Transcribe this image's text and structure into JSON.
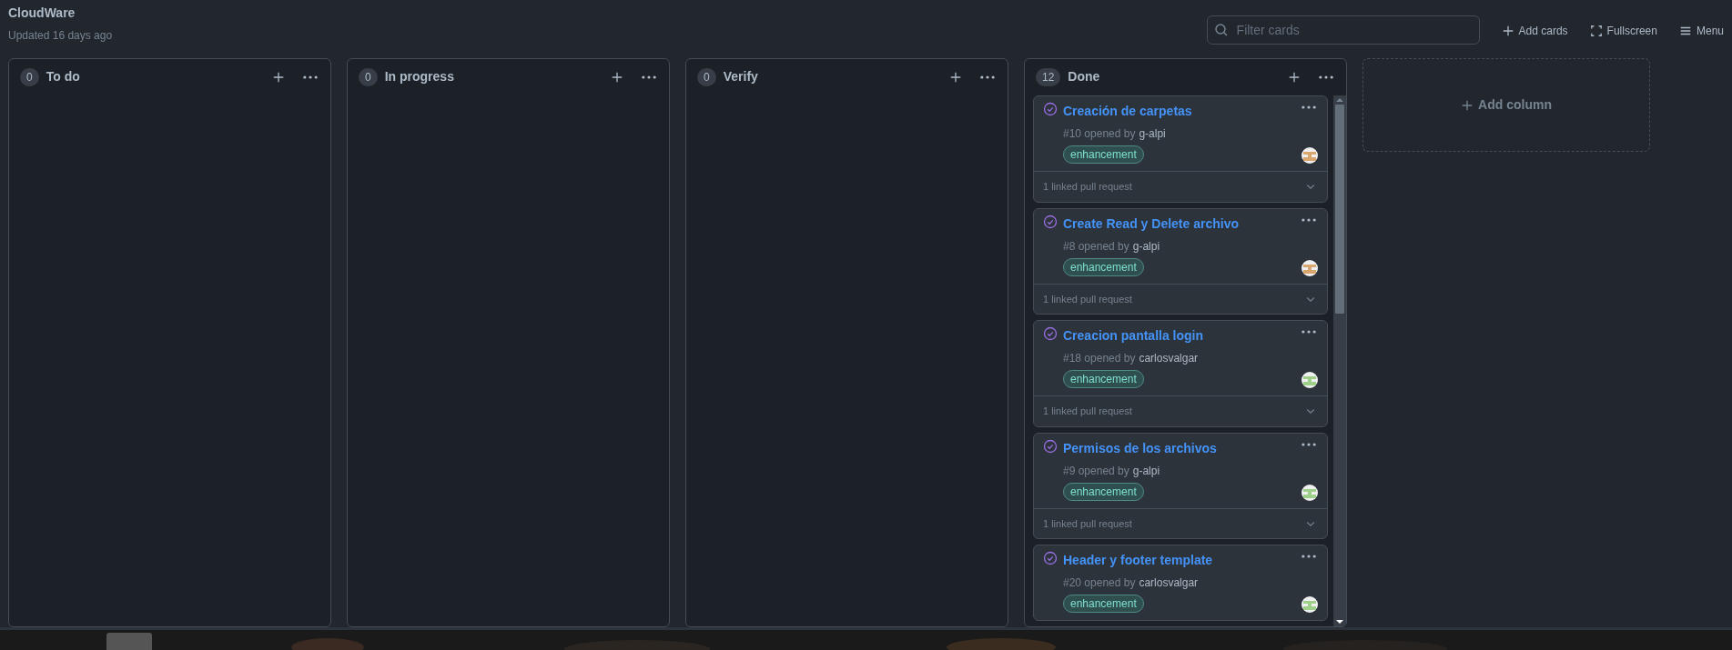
{
  "board": {
    "title": "CloudWare",
    "updated": "Updated 16 days ago"
  },
  "toolbar": {
    "search": {
      "placeholder": "Filter cards"
    },
    "actions": [
      {
        "kind": "add",
        "label": "Add cards"
      },
      {
        "kind": "fullscreen",
        "label": "Fullscreen"
      },
      {
        "kind": "menu",
        "label": "Menu"
      }
    ]
  },
  "columns": [
    {
      "count": "0",
      "name": "To do"
    },
    {
      "count": "0",
      "name": "In progress"
    },
    {
      "count": "0",
      "name": "Verify"
    },
    {
      "count": "12",
      "name": "Done",
      "cards": [
        {
          "title": "Creación de carpetas",
          "number": "#10 opened by",
          "author": "g-alpi",
          "label": "enhancement",
          "avatar": {
            "color": "#d9a66f"
          },
          "footer": "1 linked pull request"
        },
        {
          "title": "Create Read y Delete archivo",
          "number": "#8 opened by",
          "author": "g-alpi",
          "label": "enhancement",
          "avatar": {
            "color": "#d9a66f"
          },
          "footer": "1 linked pull request"
        },
        {
          "title": "Creacion pantalla login",
          "number": "#18 opened by",
          "author": "carlosvalgar",
          "label": "enhancement",
          "avatar": {
            "color": "#9fd08a"
          },
          "footer": "1 linked pull request"
        },
        {
          "title": "Permisos de los archivos",
          "number": "#9 opened by",
          "author": "g-alpi",
          "label": "enhancement",
          "avatar": {
            "color": "#9fd08a"
          },
          "footer": "1 linked pull request"
        },
        {
          "title": "Header y footer template",
          "number": "#20 opened by",
          "author": "carlosvalgar",
          "label": "enhancement",
          "avatar": {
            "color": "#9fd08a"
          }
        }
      ]
    }
  ],
  "add_column": {
    "label": "Add column"
  }
}
